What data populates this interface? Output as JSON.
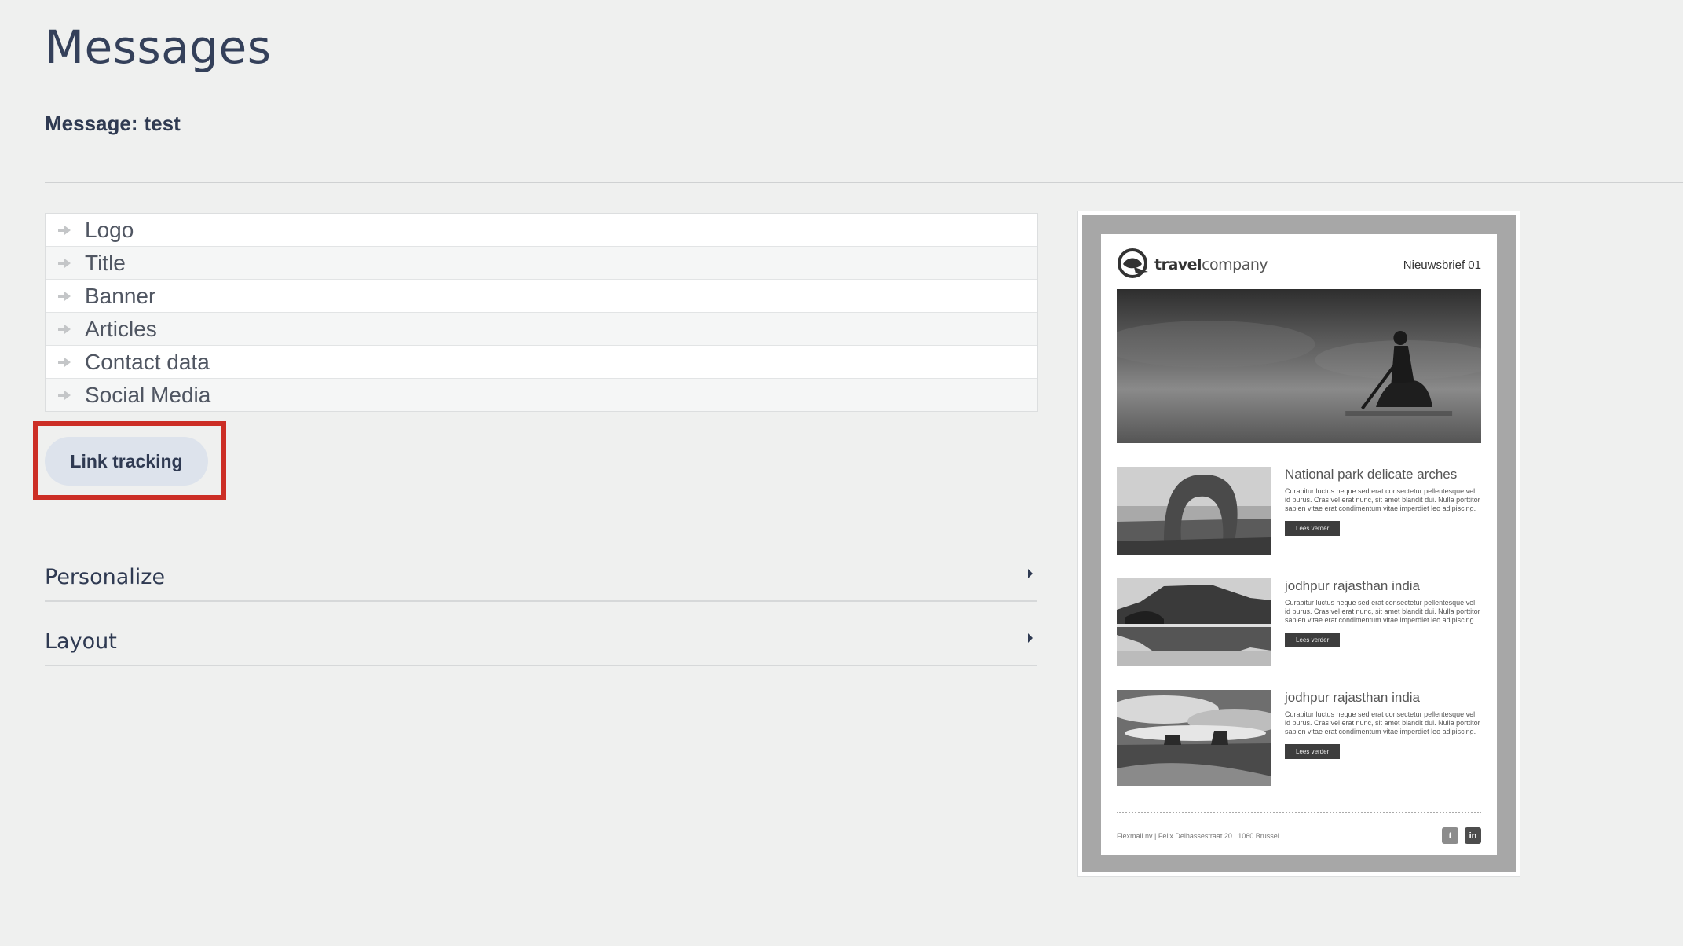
{
  "page": {
    "title": "Messages",
    "subtitle_label": "Message:",
    "subtitle_value": "test"
  },
  "blocks": [
    {
      "label": "Logo"
    },
    {
      "label": "Title"
    },
    {
      "label": "Banner"
    },
    {
      "label": "Articles"
    },
    {
      "label": "Contact data"
    },
    {
      "label": "Social Media"
    }
  ],
  "buttons": {
    "link_tracking": "Link tracking"
  },
  "sections": {
    "personalize": "Personalize",
    "layout": "Layout"
  },
  "preview": {
    "brand_bold": "travel",
    "brand_light": "company",
    "issue": "Nieuwsbrief 01",
    "articles": [
      {
        "title": "National park delicate arches",
        "body": "Curabitur luctus neque sed erat consectetur pellentesque vel id purus. Cras vel erat nunc, sit amet blandit dui. Nulla porttitor sapien vitae erat condimentum vitae imperdiet leo adipiscing.",
        "more": "Lees verder"
      },
      {
        "title": "jodhpur rajasthan india",
        "body": "Curabitur luctus neque sed erat consectetur pellentesque vel id purus. Cras vel erat nunc, sit amet blandit dui. Nulla porttitor sapien vitae erat condimentum vitae imperdiet leo adipiscing.",
        "more": "Lees verder"
      },
      {
        "title": "jodhpur rajasthan india",
        "body": "Curabitur luctus neque sed erat consectetur pellentesque vel id purus. Cras vel erat nunc, sit amet blandit dui. Nulla porttitor sapien vitae erat condimentum vitae imperdiet leo adipiscing.",
        "more": "Lees verder"
      }
    ],
    "footer": "Flexmail nv  |  Felix Delhassestraat 20  |  1060 Brussel",
    "social": [
      "twitter-icon",
      "linkedin-icon"
    ],
    "social_glyphs": [
      "t",
      "in"
    ]
  },
  "colors": {
    "background": "#eff0ef",
    "heading": "#34405a",
    "button_bg": "#dde3ec",
    "highlight": "#cc2e25"
  }
}
